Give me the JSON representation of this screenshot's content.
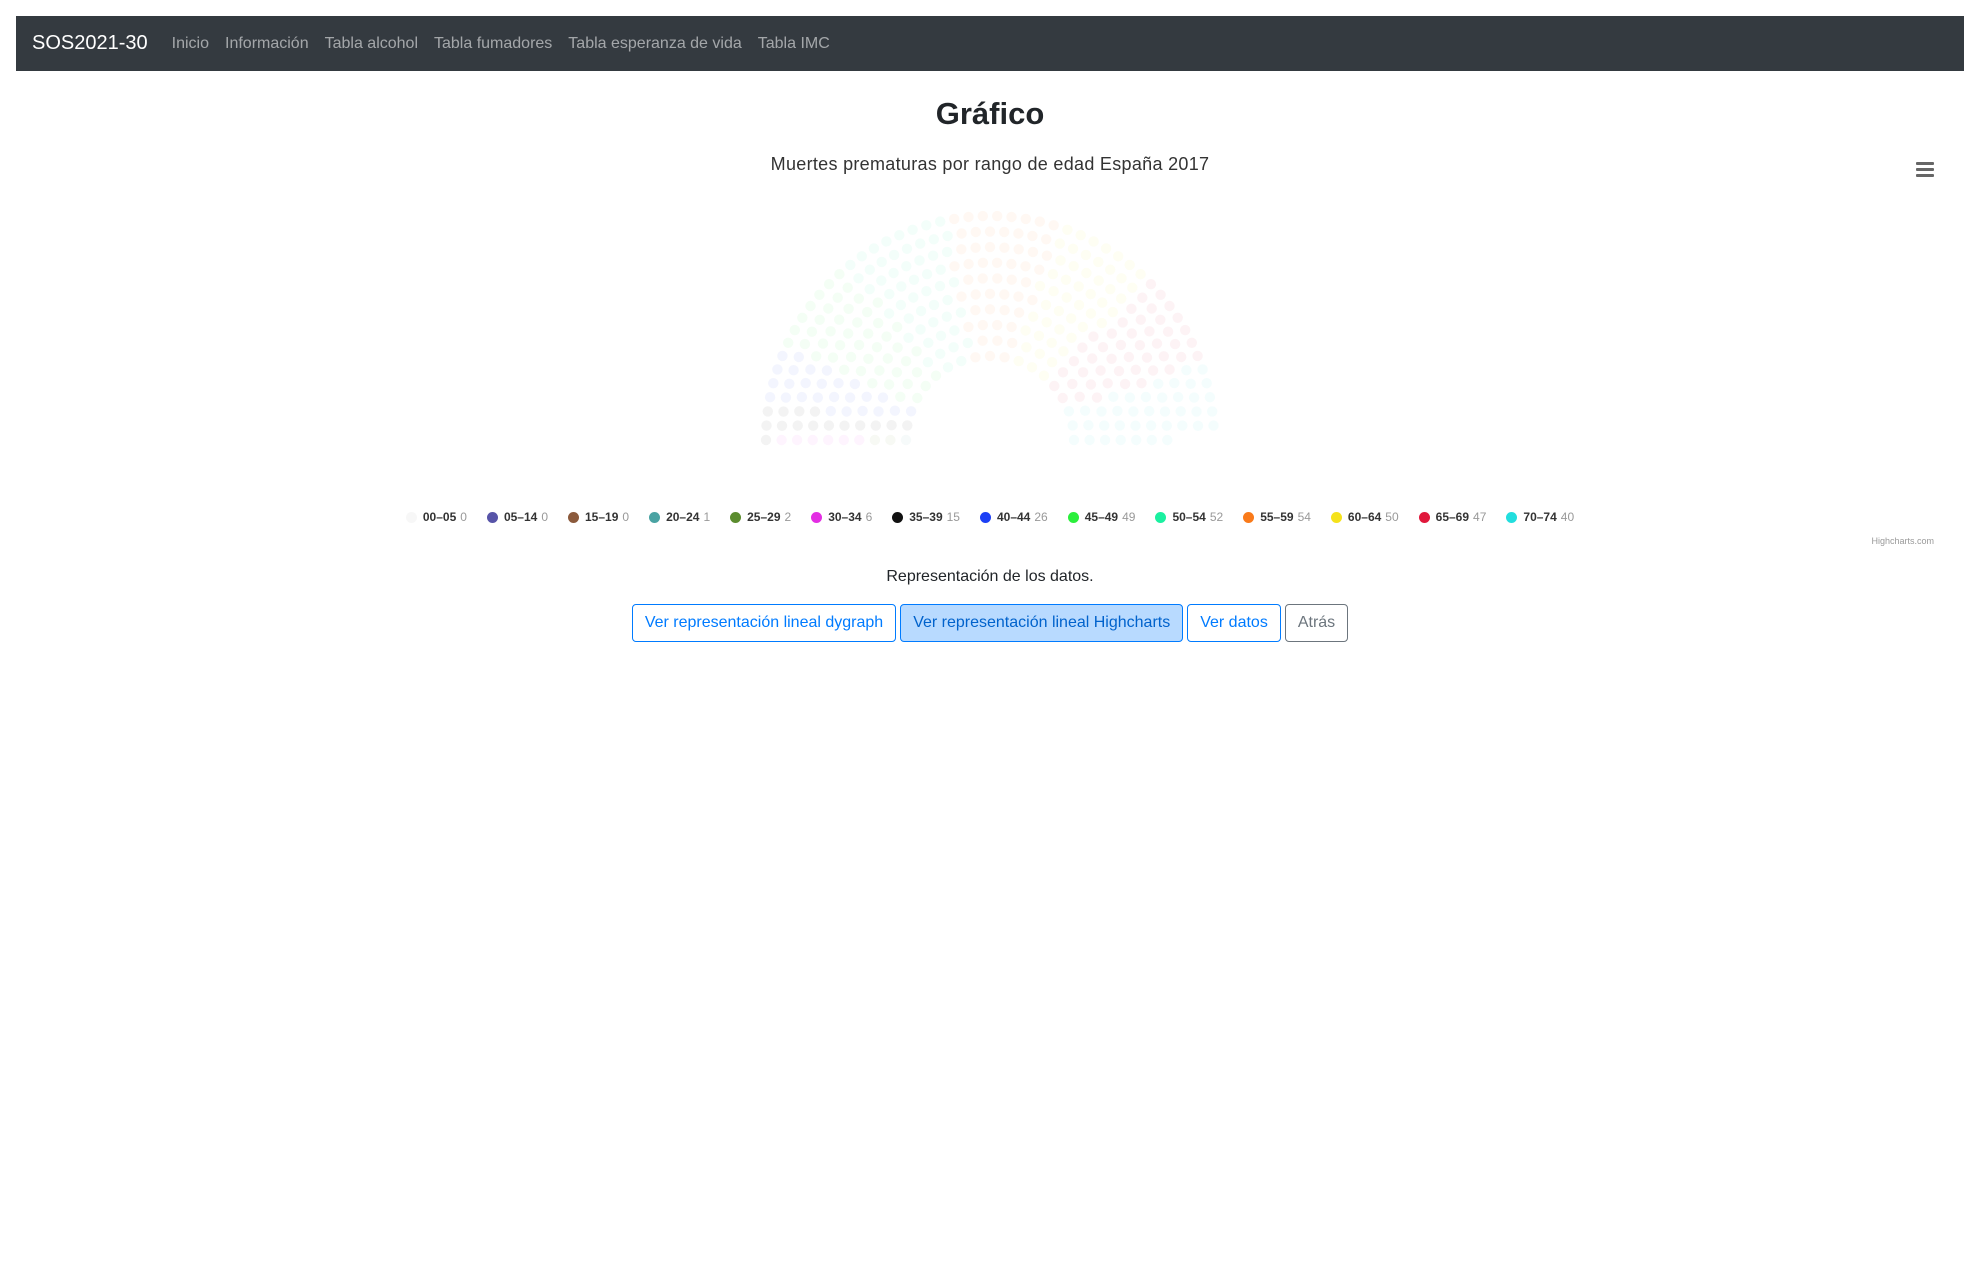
{
  "navbar": {
    "brand": "SOS2021-30",
    "links": [
      "Inicio",
      "Información",
      "Tabla alcohol",
      "Tabla fumadores",
      "Tabla esperanza de vida",
      "Tabla IMC"
    ]
  },
  "page_title": "Gráfico",
  "chart_data": {
    "type": "item",
    "title": "Muertes prematuras por rango de edad España 2017",
    "series": [
      {
        "name": "00-05",
        "value": 0,
        "color": "#f7f7f7"
      },
      {
        "name": "05-14",
        "value": 0,
        "color": "#5754a8"
      },
      {
        "name": "15-19",
        "value": 0,
        "color": "#8b5a3c"
      },
      {
        "name": "20-24",
        "value": 1,
        "color": "#4aa3a3"
      },
      {
        "name": "25-29",
        "value": 2,
        "color": "#5b8c2e"
      },
      {
        "name": "30-34",
        "value": 6,
        "color": "#e32ee3"
      },
      {
        "name": "35-39",
        "value": 15,
        "color": "#111111"
      },
      {
        "name": "40-44",
        "value": 26,
        "color": "#1c3ff5"
      },
      {
        "name": "45-49",
        "value": 49,
        "color": "#2bef3c"
      },
      {
        "name": "50-54",
        "value": 52,
        "color": "#1af0a0"
      },
      {
        "name": "55-59",
        "value": 54,
        "color": "#f97a1a"
      },
      {
        "name": "60-64",
        "value": 50,
        "color": "#f5e21b"
      },
      {
        "name": "65-69",
        "value": 47,
        "color": "#e0183c"
      },
      {
        "name": "70-74",
        "value": 40,
        "color": "#22dede"
      }
    ],
    "credits": "Highcharts.com",
    "legend": "bottom"
  },
  "description": "Representación de los datos.",
  "buttons": {
    "dygraph": "Ver representación lineal dygraph",
    "highcharts": "Ver representación lineal Highcharts",
    "ver_datos": "Ver datos",
    "atras": "Atrás"
  },
  "icons": {
    "chart_menu": "hamburger-menu-icon"
  }
}
